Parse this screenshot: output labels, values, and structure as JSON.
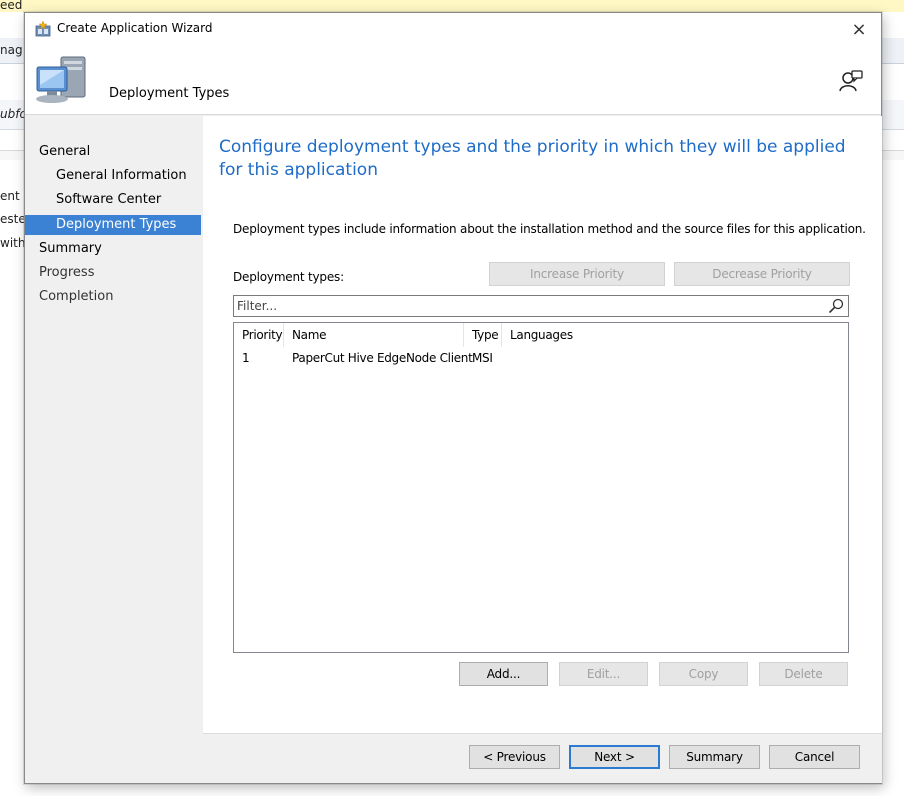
{
  "background_app": {
    "fragments": [
      "eed",
      "nag",
      "ubfo",
      "ent",
      "este",
      "with"
    ]
  },
  "dialog": {
    "title": "Create Application Wizard",
    "close_label": "×",
    "header_title": "Deployment Types",
    "icons": {
      "title_icon": "wizard-app-icon",
      "header_icon": "computer-icon",
      "help_icon": "help-person-icon"
    }
  },
  "nav": {
    "items": [
      {
        "label": "General",
        "level": 0,
        "state": "normal"
      },
      {
        "label": "General Information",
        "level": 1,
        "state": "normal"
      },
      {
        "label": "Software Center",
        "level": 1,
        "state": "normal"
      },
      {
        "label": "Deployment Types",
        "level": 1,
        "state": "selected"
      },
      {
        "label": "Summary",
        "level": 0,
        "state": "normal"
      },
      {
        "label": "Progress",
        "level": 0,
        "state": "dim"
      },
      {
        "label": "Completion",
        "level": 0,
        "state": "dim"
      }
    ]
  },
  "content": {
    "heading": "Configure deployment types and the priority in which they will be applied for this application",
    "description": "Deployment types include information about the installation method and the source files for this application.",
    "deployment_types_label": "Deployment types:",
    "increase_priority": "Increase Priority",
    "decrease_priority": "Decrease Priority",
    "filter_placeholder": "Filter...",
    "columns": [
      "Priority",
      "Name",
      "Type",
      "Languages"
    ],
    "rows": [
      {
        "priority": "1",
        "name": "PaperCut Hive EdgeNode Client",
        "type": "MSI",
        "languages": ""
      }
    ],
    "list_buttons": {
      "add": "Add...",
      "edit": "Edit...",
      "copy": "Copy",
      "delete": "Delete"
    }
  },
  "footer": {
    "previous": "< Previous",
    "next": "Next >",
    "summary": "Summary",
    "cancel": "Cancel"
  },
  "colors": {
    "accent": "#3b82d4",
    "heading": "#1e6cc8",
    "dialog_bg": "#f0f0f0"
  }
}
